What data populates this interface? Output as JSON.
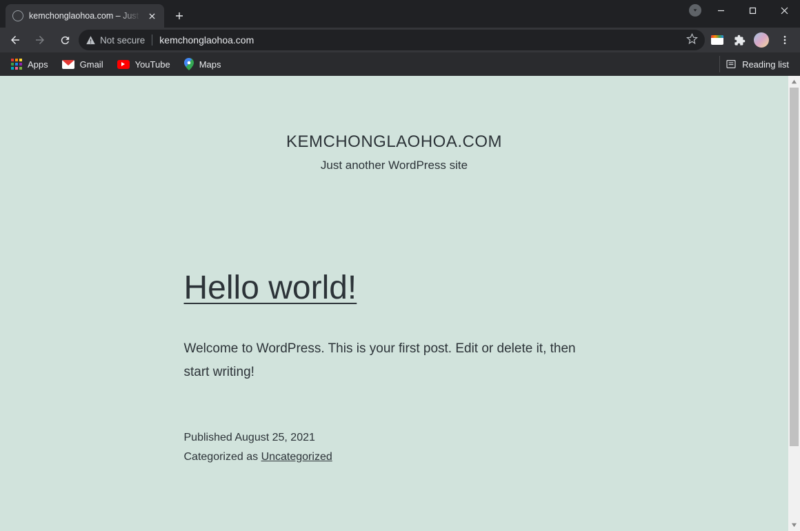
{
  "window": {
    "tab_title": "kemchonglaohoa.com – Just another WordPress site"
  },
  "toolbar": {
    "security_label": "Not secure",
    "url": "kemchonglaohoa.com"
  },
  "bookmarks": {
    "apps": "Apps",
    "gmail": "Gmail",
    "youtube": "YouTube",
    "maps": "Maps",
    "reading_list": "Reading list"
  },
  "site": {
    "title": "KEMCHONGLAOHOA.COM",
    "tagline": "Just another WordPress site"
  },
  "post": {
    "title": "Hello world!",
    "excerpt": "Welcome to WordPress. This is your first post. Edit or delete it, then start writing!",
    "published_label": "Published ",
    "published_date": "August 25, 2021",
    "categorized_label": "Categorized as ",
    "category": "Uncategorized"
  }
}
